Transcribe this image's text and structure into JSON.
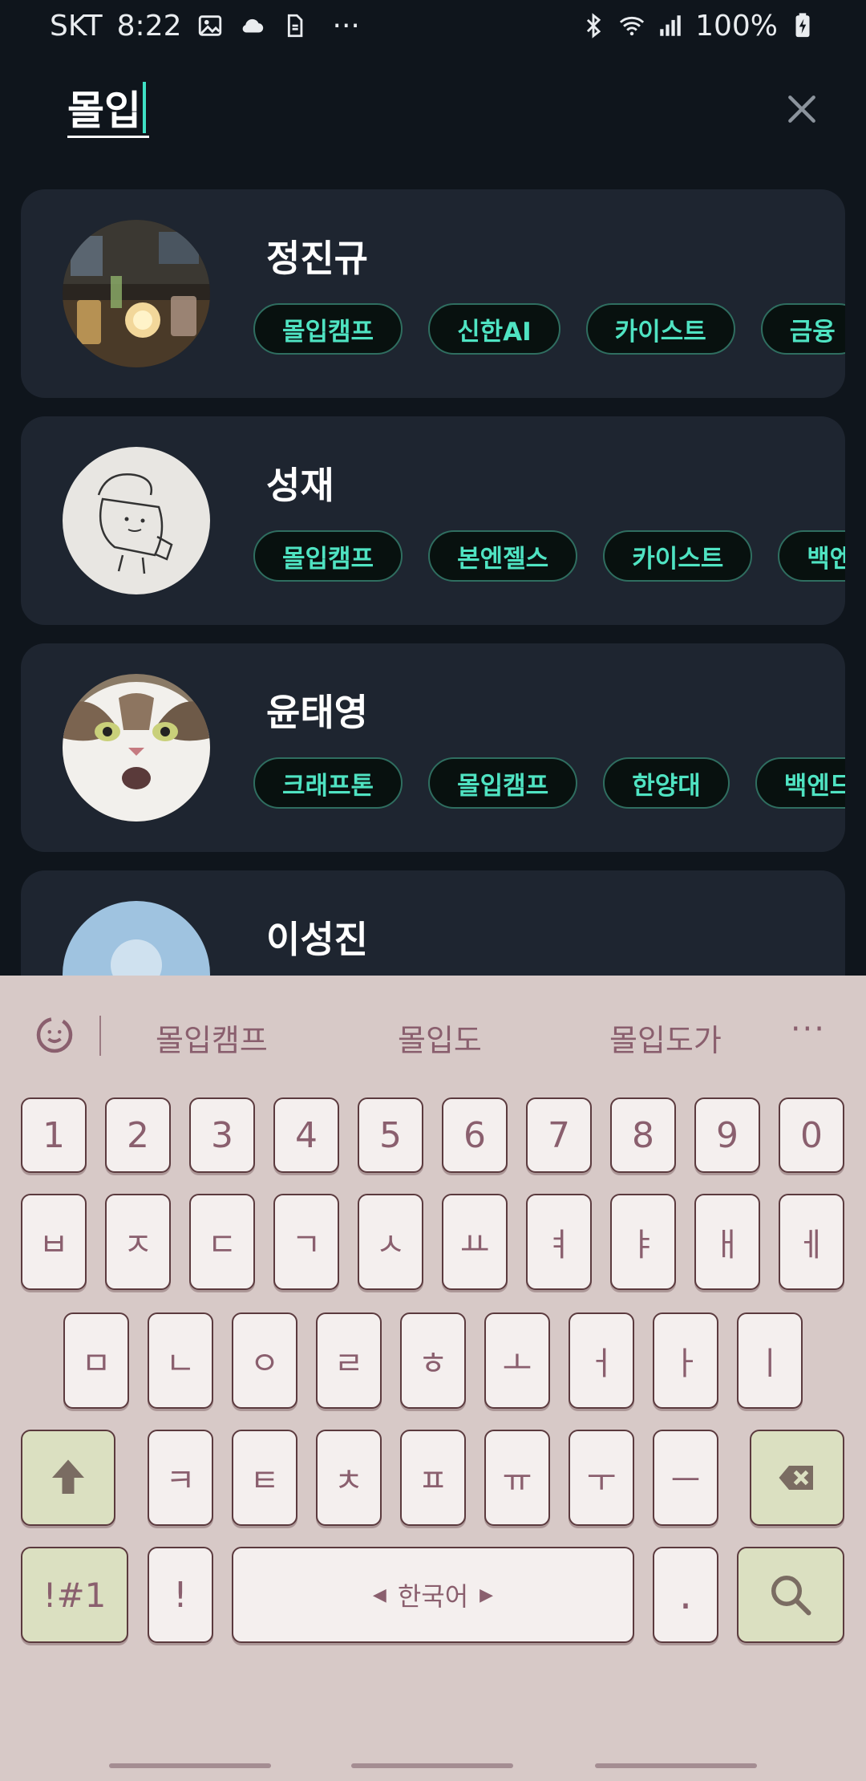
{
  "status_bar": {
    "carrier": "SKT",
    "time": "8:22",
    "battery": "100%",
    "left_icons": [
      "image-icon",
      "cloud-icon",
      "sim-icon",
      "more-dots-icon"
    ],
    "right_icons": [
      "bluetooth-icon",
      "wifi-icon",
      "signal-icon",
      "battery-icon"
    ],
    "dots": "···"
  },
  "search": {
    "query": "몰입",
    "close_icon": "close-icon"
  },
  "results": [
    {
      "name": "정진규",
      "tags": [
        "몰입캠프",
        "신한AI",
        "카이스트",
        "금융"
      ]
    },
    {
      "name": "성재",
      "tags": [
        "몰입캠프",
        "본엔젤스",
        "카이스트",
        "백엔드"
      ]
    },
    {
      "name": "윤태영",
      "tags": [
        "크래프톤",
        "몰입캠프",
        "한양대",
        "백엔드"
      ]
    },
    {
      "name": "이성진",
      "tags": []
    }
  ],
  "keyboard": {
    "suggestions": [
      "몰입캠프",
      "몰입도",
      "몰입도가"
    ],
    "more": "···",
    "row_numbers": [
      "1",
      "2",
      "3",
      "4",
      "5",
      "6",
      "7",
      "8",
      "9",
      "0"
    ],
    "row1": [
      "ㅂ",
      "ㅈ",
      "ㄷ",
      "ㄱ",
      "ㅅ",
      "ㅛ",
      "ㅕ",
      "ㅑ",
      "ㅐ",
      "ㅔ"
    ],
    "row2": [
      "ㅁ",
      "ㄴ",
      "ㅇ",
      "ㄹ",
      "ㅎ",
      "ㅗ",
      "ㅓ",
      "ㅏ",
      "ㅣ"
    ],
    "row3": [
      "ㅋ",
      "ㅌ",
      "ㅊ",
      "ㅍ",
      "ㅠ",
      "ㅜ",
      "ㅡ"
    ],
    "symbols_key": "!#1",
    "exclaim_key": "!",
    "space_label": "한국어",
    "period_key": ".",
    "accent_key_color": "#dbe0c1",
    "background_color": "#d7c9c7"
  },
  "colors": {
    "background": "#0f151c",
    "card": "#1e2530",
    "tag_text": "#4fe3c2",
    "tag_border": "#2f6e60",
    "caret": "#3fe0c5"
  }
}
